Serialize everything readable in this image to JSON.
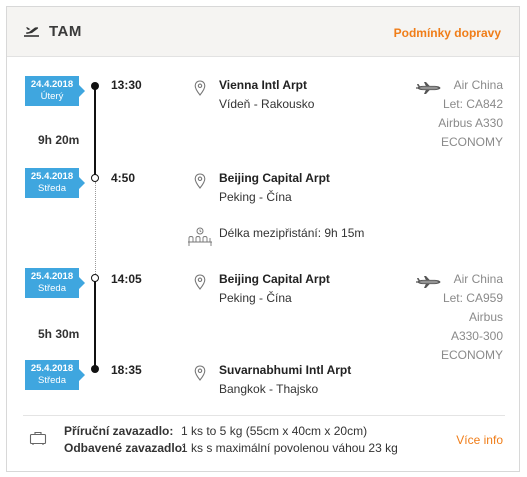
{
  "header": {
    "title": "TAM",
    "conditions_link": "Podmínky dopravy"
  },
  "segments": [
    {
      "dep_date": "24.4.2018",
      "dep_day": "Úterý",
      "dep_time": "13:30",
      "dep_airport": "Vienna Intl Arpt",
      "dep_place": "Vídeň - Rakousko",
      "duration": "9h 20m",
      "arr_date": "25.4.2018",
      "arr_day": "Středa",
      "arr_time": "4:50",
      "arr_airport": "Beijing Capital Arpt",
      "arr_place": "Peking - Čína",
      "carrier": "Air China",
      "flight": "Let: CA842",
      "aircraft": "Airbus A330",
      "aircraft2": "",
      "cabin": "ECONOMY"
    },
    {
      "dep_date": "25.4.2018",
      "dep_day": "Středa",
      "dep_time": "14:05",
      "dep_airport": "Beijing Capital Arpt",
      "dep_place": "Peking - Čína",
      "duration": "5h 30m",
      "arr_date": "25.4.2018",
      "arr_day": "Středa",
      "arr_time": "18:35",
      "arr_airport": "Suvarnabhumi Intl Arpt",
      "arr_place": "Bangkok - Thajsko",
      "carrier": "Air China",
      "flight": "Let: CA959",
      "aircraft": "Airbus",
      "aircraft2": "A330-300",
      "cabin": "ECONOMY"
    }
  ],
  "layover": "Délka mezipřistání: 9h 15m",
  "baggage": {
    "carry_on_label": "Příruční zavazadlo:",
    "carry_on_value": "1 ks to 5 kg (55cm x 40cm x 20cm)",
    "checked_label": "Odbavené zavazadlo:",
    "checked_value": "1 ks s maximální povolenou váhou 23 kg",
    "more_link": "Více info"
  },
  "colors": {
    "accent": "#f07d18",
    "badge": "#3fa6df",
    "header_bg": "#f5f4f2"
  },
  "icons": [
    "plane-departure-icon",
    "map-pin-icon",
    "airplane-icon",
    "waiting-seats-icon",
    "luggage-icon"
  ]
}
